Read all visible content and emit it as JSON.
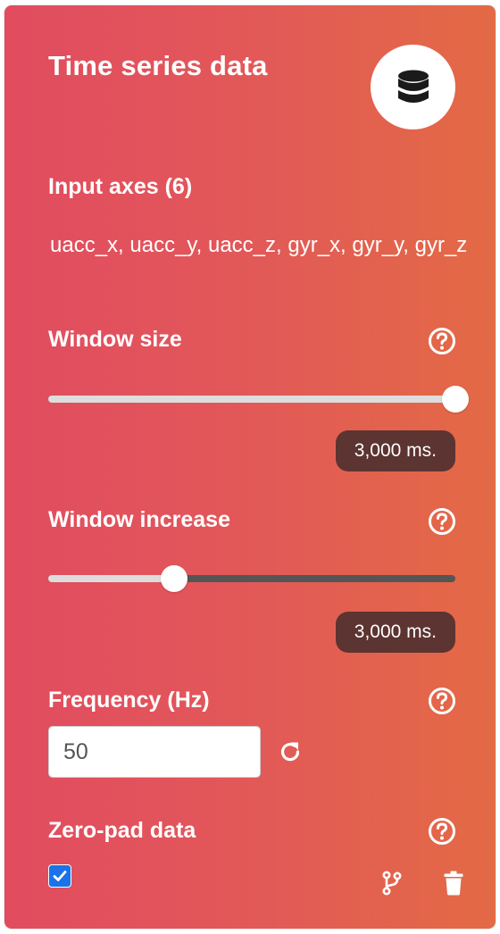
{
  "card": {
    "title": "Time series data",
    "badge_icon": "database-icon"
  },
  "input_axes": {
    "label": "Input axes (6)",
    "value": "uacc_x, uacc_y, uacc_z, gyr_x, gyr_y, gyr_z"
  },
  "window_size": {
    "label": "Window size",
    "value_label": "3,000 ms.",
    "slider_fraction": 1.0
  },
  "window_increase": {
    "label": "Window increase",
    "value_label": "3,000 ms.",
    "slider_fraction": 0.31
  },
  "frequency": {
    "label": "Frequency (Hz)",
    "value": "50"
  },
  "zero_pad": {
    "label": "Zero-pad data",
    "checked": true
  },
  "icons": {
    "help": "question-circle-icon",
    "refresh": "redo-icon",
    "branch": "code-branch-icon",
    "delete": "trash-icon"
  },
  "colors": {
    "gradient_start": "#e14c5f",
    "gradient_end": "#e36a45",
    "pill": "#5c3431",
    "checkbox": "#1a73e8"
  }
}
